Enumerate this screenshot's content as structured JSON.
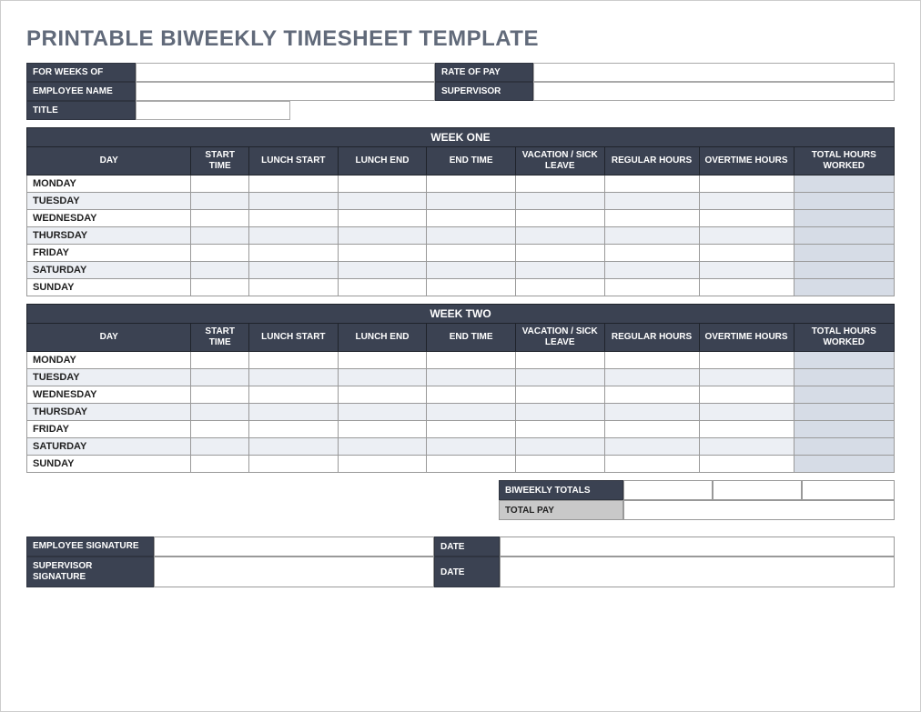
{
  "page_title": "PRINTABLE BIWEEKLY TIMESHEET TEMPLATE",
  "header": {
    "for_weeks_of_label": "FOR WEEKS OF",
    "for_weeks_of_value": "",
    "rate_of_pay_label": "RATE OF PAY",
    "rate_of_pay_value": "",
    "employee_name_label": "EMPLOYEE NAME",
    "employee_name_value": "",
    "supervisor_label": "SUPERVISOR",
    "supervisor_value": "",
    "title_label": "TITLE",
    "title_value": ""
  },
  "columns": {
    "day": "DAY",
    "start_time": "START TIME",
    "lunch_start": "LUNCH START",
    "lunch_end": "LUNCH END",
    "end_time": "END TIME",
    "vacation_sick": "VACATION / SICK LEAVE",
    "regular_hours": "REGULAR HOURS",
    "overtime_hours": "OVERTIME HOURS",
    "total_hours": "TOTAL HOURS WORKED"
  },
  "weeks": [
    {
      "title": "WEEK ONE",
      "days": [
        {
          "name": "MONDAY",
          "start": "",
          "lunch_start": "",
          "lunch_end": "",
          "end": "",
          "vac": "",
          "reg": "",
          "ot": "",
          "total": ""
        },
        {
          "name": "TUESDAY",
          "start": "",
          "lunch_start": "",
          "lunch_end": "",
          "end": "",
          "vac": "",
          "reg": "",
          "ot": "",
          "total": ""
        },
        {
          "name": "WEDNESDAY",
          "start": "",
          "lunch_start": "",
          "lunch_end": "",
          "end": "",
          "vac": "",
          "reg": "",
          "ot": "",
          "total": ""
        },
        {
          "name": "THURSDAY",
          "start": "",
          "lunch_start": "",
          "lunch_end": "",
          "end": "",
          "vac": "",
          "reg": "",
          "ot": "",
          "total": ""
        },
        {
          "name": "FRIDAY",
          "start": "",
          "lunch_start": "",
          "lunch_end": "",
          "end": "",
          "vac": "",
          "reg": "",
          "ot": "",
          "total": ""
        },
        {
          "name": "SATURDAY",
          "start": "",
          "lunch_start": "",
          "lunch_end": "",
          "end": "",
          "vac": "",
          "reg": "",
          "ot": "",
          "total": ""
        },
        {
          "name": "SUNDAY",
          "start": "",
          "lunch_start": "",
          "lunch_end": "",
          "end": "",
          "vac": "",
          "reg": "",
          "ot": "",
          "total": ""
        }
      ]
    },
    {
      "title": "WEEK TWO",
      "days": [
        {
          "name": "MONDAY",
          "start": "",
          "lunch_start": "",
          "lunch_end": "",
          "end": "",
          "vac": "",
          "reg": "",
          "ot": "",
          "total": ""
        },
        {
          "name": "TUESDAY",
          "start": "",
          "lunch_start": "",
          "lunch_end": "",
          "end": "",
          "vac": "",
          "reg": "",
          "ot": "",
          "total": ""
        },
        {
          "name": "WEDNESDAY",
          "start": "",
          "lunch_start": "",
          "lunch_end": "",
          "end": "",
          "vac": "",
          "reg": "",
          "ot": "",
          "total": ""
        },
        {
          "name": "THURSDAY",
          "start": "",
          "lunch_start": "",
          "lunch_end": "",
          "end": "",
          "vac": "",
          "reg": "",
          "ot": "",
          "total": ""
        },
        {
          "name": "FRIDAY",
          "start": "",
          "lunch_start": "",
          "lunch_end": "",
          "end": "",
          "vac": "",
          "reg": "",
          "ot": "",
          "total": ""
        },
        {
          "name": "SATURDAY",
          "start": "",
          "lunch_start": "",
          "lunch_end": "",
          "end": "",
          "vac": "",
          "reg": "",
          "ot": "",
          "total": ""
        },
        {
          "name": "SUNDAY",
          "start": "",
          "lunch_start": "",
          "lunch_end": "",
          "end": "",
          "vac": "",
          "reg": "",
          "ot": "",
          "total": ""
        }
      ]
    }
  ],
  "totals": {
    "biweekly_totals_label": "BIWEEKLY TOTALS",
    "biweekly_regular": "",
    "biweekly_overtime": "",
    "biweekly_total": "",
    "total_pay_label": "TOTAL PAY",
    "total_pay_value": ""
  },
  "signatures": {
    "employee_sig_label": "EMPLOYEE SIGNATURE",
    "employee_sig_value": "",
    "employee_date_label": "DATE",
    "employee_date_value": "",
    "supervisor_sig_label": "SUPERVISOR SIGNATURE",
    "supervisor_sig_value": "",
    "supervisor_date_label": "DATE",
    "supervisor_date_value": ""
  }
}
